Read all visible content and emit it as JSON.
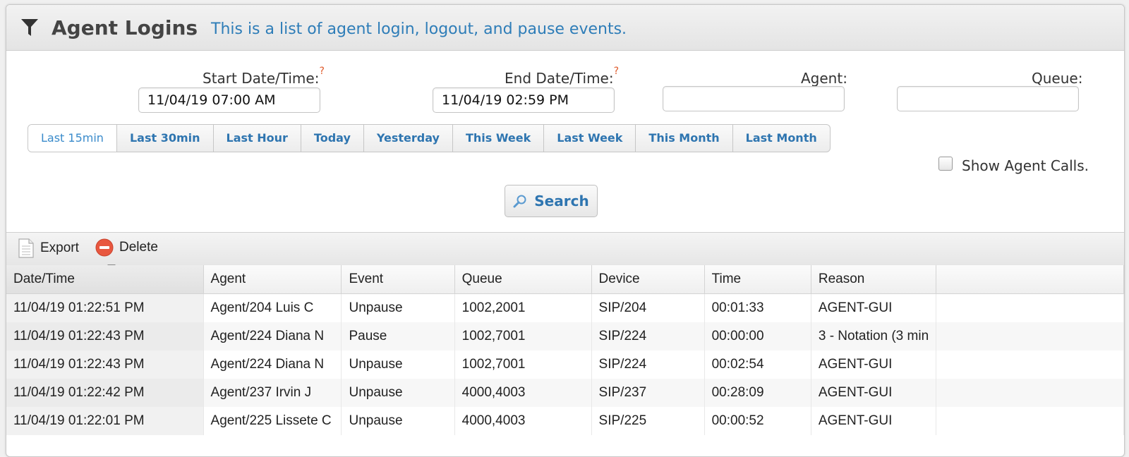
{
  "header": {
    "title": "Agent Logins",
    "subtitle": "This is a list of agent login, logout, and pause events."
  },
  "form": {
    "start_label": "Start Date/Time:",
    "start_value": "11/04/19 07:00 AM",
    "end_label": "End Date/Time:",
    "end_value": "11/04/19 02:59 PM",
    "required_mark": "?",
    "agent_label": "Agent:",
    "agent_value": "",
    "queue_label": "Queue:",
    "queue_value": "",
    "show_calls_label": "Show Agent Calls.",
    "show_calls_checked": false,
    "search_label": "Search"
  },
  "ranges": [
    "Last 15min",
    "Last 30min",
    "Last Hour",
    "Today",
    "Yesterday",
    "This Week",
    "Last Week",
    "This Month",
    "Last Month"
  ],
  "active_range": "Last 15min",
  "toolbar": {
    "export_label": "Export",
    "delete_label": "Delete"
  },
  "table": {
    "columns": [
      "Date/Time",
      "Agent",
      "Event",
      "Queue",
      "Device",
      "Time",
      "Reason"
    ],
    "rows": [
      [
        "11/04/19 01:22:51 PM",
        "Agent/204 Luis C",
        "Unpause",
        "1002,2001",
        "SIP/204",
        "00:01:33",
        "AGENT-GUI"
      ],
      [
        "11/04/19 01:22:43 PM",
        "Agent/224 Diana N",
        "Pause",
        "1002,7001",
        "SIP/224",
        "00:00:00",
        "3 - Notation (3 min"
      ],
      [
        "11/04/19 01:22:43 PM",
        "Agent/224 Diana N",
        "Unpause",
        "1002,7001",
        "SIP/224",
        "00:02:54",
        "AGENT-GUI"
      ],
      [
        "11/04/19 01:22:42 PM",
        "Agent/237 Irvin J",
        "Unpause",
        "4000,4003",
        "SIP/237",
        "00:28:09",
        "AGENT-GUI"
      ],
      [
        "11/04/19 01:22:01 PM",
        "Agent/225 Lissete C",
        "Unpause",
        "4000,4003",
        "SIP/225",
        "00:00:52",
        "AGENT-GUI"
      ]
    ]
  },
  "colors": {
    "accent": "#2e75b0",
    "subtitle": "#2e7db8",
    "required": "#e05a2a",
    "delete": "#e8573f"
  }
}
